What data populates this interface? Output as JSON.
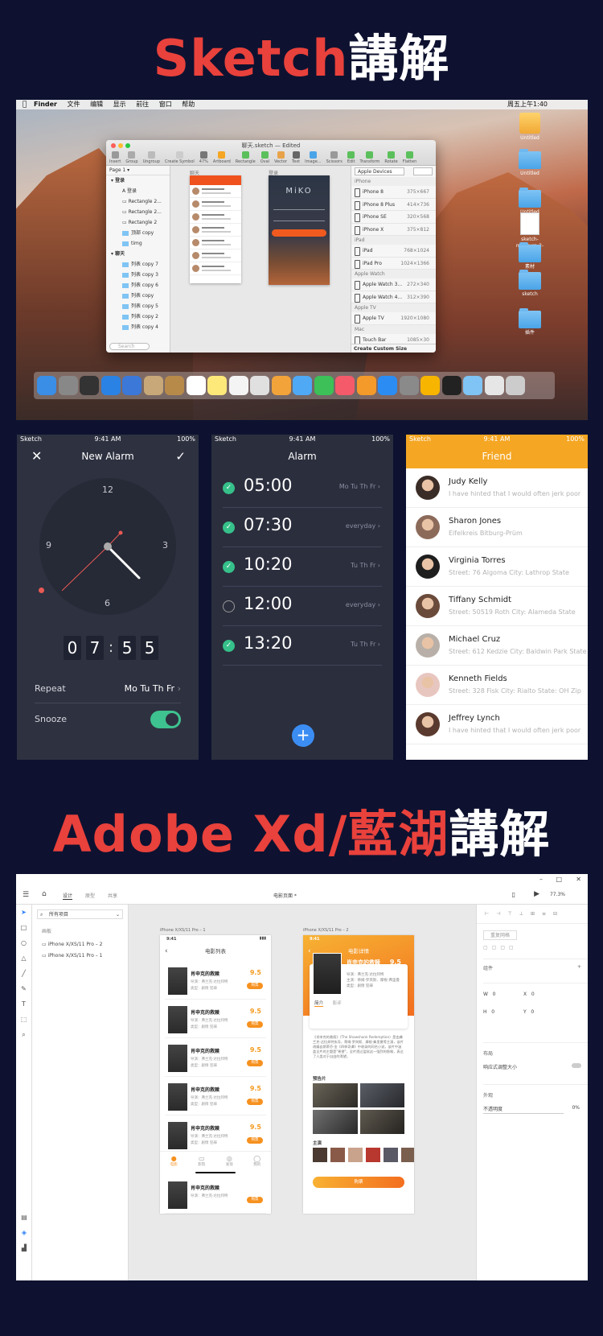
{
  "header1": {
    "red": "Sketch",
    "white": "講解"
  },
  "header2": {
    "red": "Adobe Xd/藍湖",
    "white": "講解"
  },
  "mac": {
    "menubar": {
      "app": "Finder",
      "items": [
        "文件",
        "编辑",
        "显示",
        "前往",
        "窗口",
        "帮助"
      ],
      "clock": "周五上午1:40"
    },
    "desktop_icons": [
      "Untitled",
      "Untitled",
      "Untitled",
      "sketch-measure-2-2-2.jpg",
      "素材",
      "sketch",
      "插件"
    ],
    "sketch": {
      "title": "聊天.sketch — Edited",
      "tools": [
        "Insert",
        "Group",
        "Ungroup",
        "Create Symbol",
        "47%",
        "Artboard",
        "Rectangle",
        "Oval",
        "Vector",
        "Text",
        "Image...",
        "Scissors",
        "Edit",
        "Transform",
        "Rotate",
        "Flatten"
      ],
      "page": "Page 1",
      "layers": [
        {
          "label": "登录",
          "type": "header"
        },
        {
          "label": "登录",
          "type": "text"
        },
        {
          "label": "Rectangle 2...",
          "type": "shape"
        },
        {
          "label": "Rectangle 2...",
          "type": "shape"
        },
        {
          "label": "Rectangle 2",
          "type": "shape"
        },
        {
          "label": "顶部 copy",
          "type": "folder"
        },
        {
          "label": "timg",
          "type": "folder"
        },
        {
          "label": "聊天",
          "type": "header"
        },
        {
          "label": "列表 copy 7",
          "type": "folder"
        },
        {
          "label": "列表 copy 3",
          "type": "folder"
        },
        {
          "label": "列表 copy 6",
          "type": "folder"
        },
        {
          "label": "列表 copy",
          "type": "folder"
        },
        {
          "label": "列表 copy 5",
          "type": "folder"
        },
        {
          "label": "列表 copy 2",
          "type": "folder"
        },
        {
          "label": "列表 copy 4",
          "type": "folder"
        }
      ],
      "search_placeholder": "Search",
      "artboard1": "聊天",
      "artboard2": "登录",
      "login_brand": "MiKO",
      "device_select": "Apple Devices",
      "devices": [
        {
          "cat": "iPhone"
        },
        {
          "name": "iPhone 8",
          "size": "375×667"
        },
        {
          "name": "iPhone 8 Plus",
          "size": "414×736"
        },
        {
          "name": "iPhone SE",
          "size": "320×568"
        },
        {
          "name": "iPhone X",
          "size": "375×812"
        },
        {
          "cat": "iPad"
        },
        {
          "name": "iPad",
          "size": "768×1024"
        },
        {
          "name": "iPad Pro",
          "size": "1024×1366"
        },
        {
          "cat": "Apple Watch"
        },
        {
          "name": "Apple Watch 3...",
          "size": "272×340"
        },
        {
          "name": "Apple Watch 4...",
          "size": "312×390"
        },
        {
          "cat": "Apple TV"
        },
        {
          "name": "Apple TV",
          "size": "1920×1080"
        },
        {
          "cat": "Mac"
        },
        {
          "name": "Touch Bar",
          "size": "1085×30"
        }
      ],
      "create_custom": "Create Custom Size"
    }
  },
  "alarm_edit": {
    "status": {
      "left": "Sketch",
      "time": "9:41 AM",
      "battery": "100%"
    },
    "title": "New Alarm",
    "clock_numbers": [
      "12",
      "3",
      "6",
      "9"
    ],
    "digits": [
      "0",
      "7",
      "5",
      "5"
    ],
    "repeat_label": "Repeat",
    "repeat_value": "Mo Tu Th Fr",
    "snooze_label": "Snooze",
    "snooze_on": true
  },
  "alarm_list": {
    "status": {
      "left": "Sketch",
      "time": "9:41 AM",
      "battery": "100%"
    },
    "title": "Alarm",
    "alarms": [
      {
        "time": "05:00",
        "days": "Mo Tu Th Fr",
        "on": true
      },
      {
        "time": "07:30",
        "days": "everyday",
        "on": true
      },
      {
        "time": "10:20",
        "days": "Tu Th Fr",
        "on": true
      },
      {
        "time": "12:00",
        "days": "everyday",
        "on": false
      },
      {
        "time": "13:20",
        "days": "Tu Th Fr",
        "on": true
      }
    ],
    "add": "+"
  },
  "friends": {
    "status": {
      "left": "Sketch",
      "time": "9:41 AM",
      "battery": "100%"
    },
    "title": "Friend",
    "list": [
      {
        "name": "Judy Kelly",
        "sub": "I have hinted that I would often jerk poor"
      },
      {
        "name": "Sharon Jones",
        "sub": "Eifelkreis Bitburg-Prüm"
      },
      {
        "name": "Virginia Torres",
        "sub": "Street: 76 Algoma City: Lathrop State"
      },
      {
        "name": "Tiffany Schmidt",
        "sub": "Street: 50519 Roth City: Alameda State"
      },
      {
        "name": "Michael Cruz",
        "sub": "Street: 612 Kedzie City: Baldwin Park State"
      },
      {
        "name": "Kenneth Fields",
        "sub": "Street: 328 Fisk City: Rialto State: OH Zip"
      },
      {
        "name": "Jeffrey Lynch",
        "sub": "I have hinted that I would often jerk poor"
      }
    ]
  },
  "xd": {
    "tabs": [
      "设计",
      "原型",
      "共享"
    ],
    "doc_title": "电影页面 *",
    "zoom": "77.3%",
    "search": "所有项目",
    "layers_head": "画板",
    "layers": [
      "iPhone X/XS/11 Pro – 2",
      "iPhone X/XS/11 Pro – 1"
    ],
    "ab1_label": "iPhone X/XS/11 Pro – 1",
    "ab2_label": "iPhone X/XS/11 Pro – 2",
    "list_title": "电影列表",
    "status_time": "9:41",
    "movie": {
      "title": "肖申克的救赎",
      "score": "9.5",
      "line1": "导演：弗兰克·达拉邦特",
      "line2": "类型：剧情  犯罪",
      "btn": "购票"
    },
    "tabbar": [
      "电影",
      "影院",
      "发现",
      "我的"
    ],
    "detail_title": "电影详情",
    "detail_line1": "导演：弗兰克·达拉邦特",
    "detail_line2": "主演：蒂姆·罗宾斯、摩根·弗里曼",
    "detail_line3": "类型：剧情  犯罪",
    "detail_tabs": [
      "简介",
      "影评"
    ],
    "detail_text": "《肖申克的救赎》（The Shawshank Redemption）是由弗兰克·达拉邦特执导，蒂姆·罗宾斯、摩根·弗里曼等主演，该片改编自斯蒂芬·金《四季奇谭》中收录的同名小说，该片中涵盖全片的主题是\"希望\"，全片透过监狱这一强烈的隐喻，表达了人类对于自由的渴望。",
    "trailer": "预告片",
    "cast": "主演",
    "buy": "购票",
    "props": {
      "btn": "重复网格",
      "component": "组件",
      "w": "W",
      "h": "H",
      "x": "X",
      "y": "Y",
      "w_val": "0",
      "h_val": "0",
      "x_val": "0",
      "y_val": "0",
      "layout": "布局",
      "responsive": "响应式调整大小",
      "appearance": "外观",
      "opacity_label": "不透明度",
      "opacity": "0%"
    }
  },
  "colors": {
    "accent_red": "#e9413c",
    "bg": "#0e1230",
    "alarm_green": "#36c08a",
    "friend_orange": "#f5a623",
    "xd_orange": "#f6911f"
  }
}
